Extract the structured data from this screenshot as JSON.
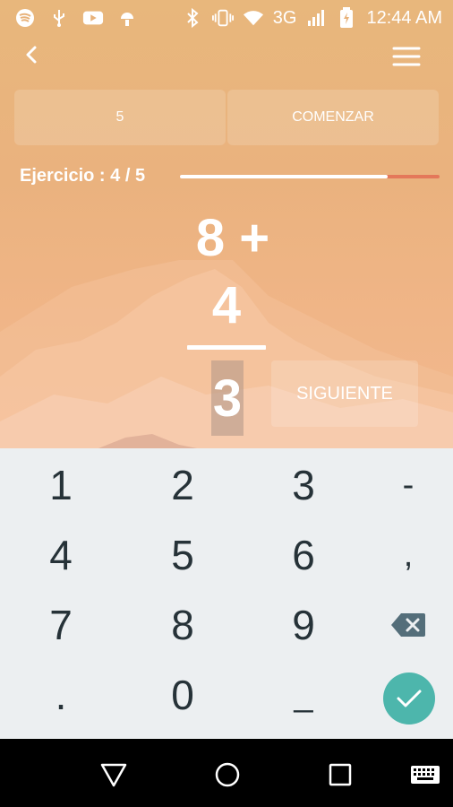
{
  "status_bar": {
    "left_icons": [
      "spotify-icon",
      "usb-icon",
      "youtube-icon",
      "android-debug-icon"
    ],
    "right_icons": [
      "bluetooth-icon",
      "vibrate-icon",
      "wifi-icon",
      "signal-icon",
      "battery-icon"
    ],
    "network": "3G",
    "time": "12:44 AM"
  },
  "toolbar": {
    "back_icon": "chevron-left-icon",
    "menu_icon": "hamburger-menu-icon"
  },
  "mode_selector": {
    "left_label": "5",
    "right_label": "COMENZAR"
  },
  "exercise": {
    "label": "Ejercicio : 4 / 5",
    "progress": 0.8,
    "operand1": "8 +",
    "operand2": "4",
    "answer": "3",
    "next_label": "SIGUIENTE"
  },
  "keypad": {
    "rows": [
      [
        "1",
        "2",
        "3",
        "-"
      ],
      [
        "4",
        "5",
        "6",
        ","
      ],
      [
        "7",
        "8",
        "9",
        "⌫"
      ],
      [
        ".",
        "0",
        "_",
        "✓"
      ]
    ]
  },
  "nav_bar": {
    "items": [
      "back-triangle-icon",
      "home-circle-icon",
      "recents-square-icon",
      "keyboard-icon"
    ]
  },
  "colors": {
    "background": "#e8b27a",
    "progress_remaining": "#e4785a",
    "keypad_bg": "#eceff1",
    "key_text": "#263238",
    "done_button": "#4db6ac"
  }
}
